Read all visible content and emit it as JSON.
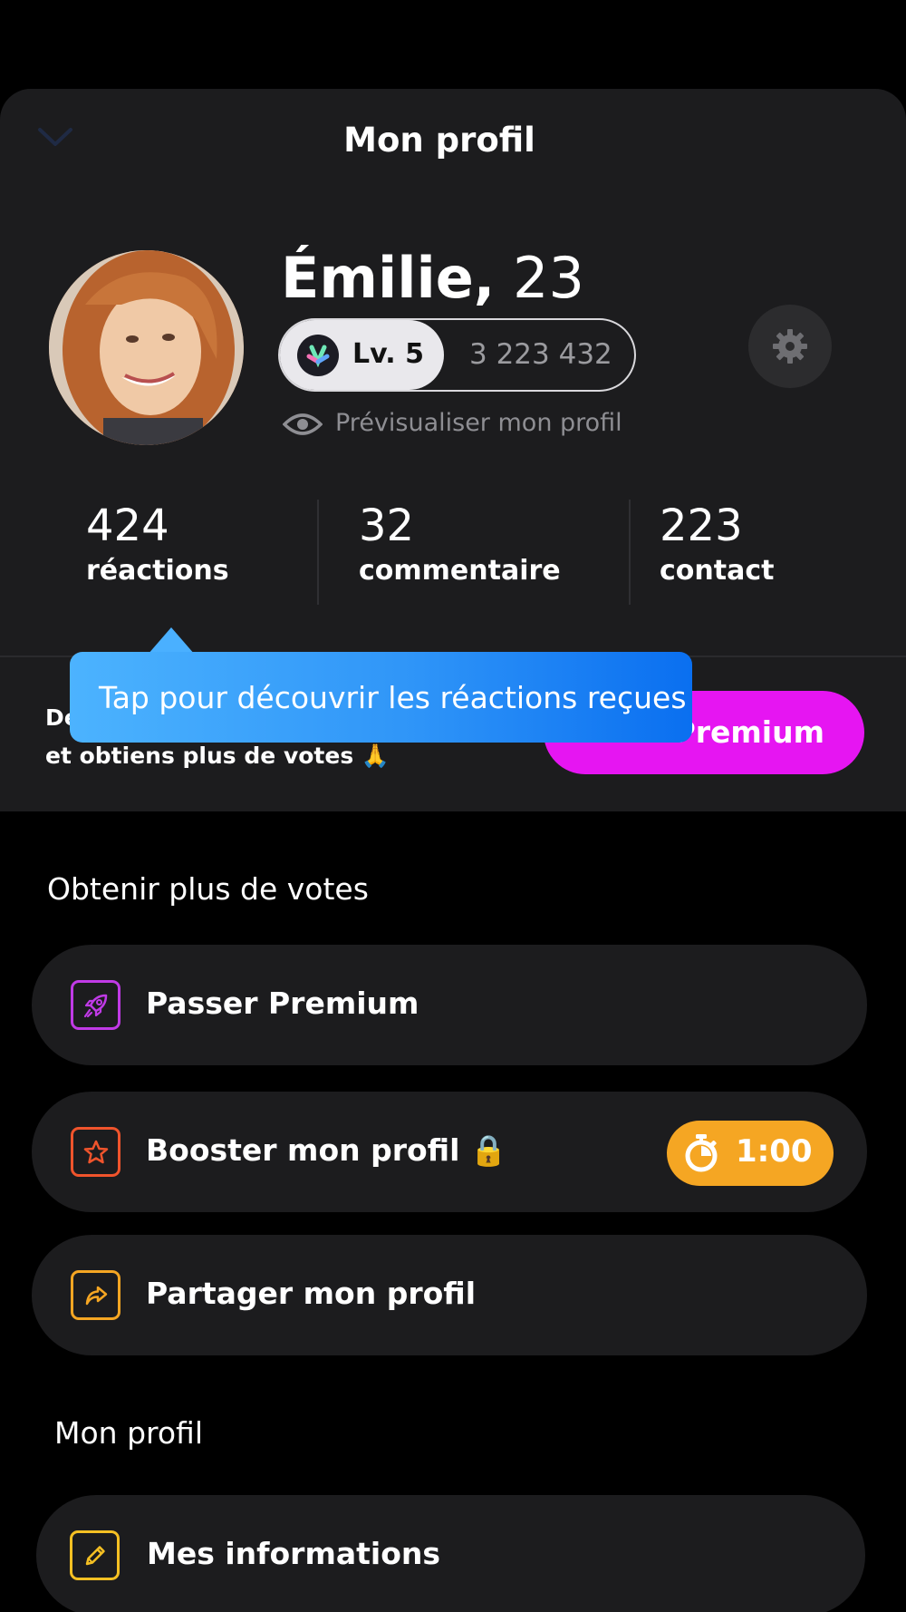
{
  "header": {
    "title": "Mon profil"
  },
  "profile": {
    "name": "Émilie,",
    "age": "23",
    "level": "Lv. 5",
    "points": "3 223 432",
    "preview_link": "Prévisualiser mon profil"
  },
  "stats": [
    {
      "value": "424",
      "label": "réactions"
    },
    {
      "value": "32",
      "label": "commentaire"
    },
    {
      "value": "223",
      "label": "contact"
    }
  ],
  "promo": {
    "text_line1": "De",
    "text_line2": "et obtiens plus de votes 🙏",
    "button": "Premium"
  },
  "tooltip": {
    "text": "Tap pour découvrir les réactions reçues"
  },
  "votes_section": {
    "title": "Obtenir plus de votes",
    "items": [
      {
        "label": "Passer Premium",
        "icon": "rocket-icon",
        "color": "#c03ae6"
      },
      {
        "label": "Booster mon profil 🔒",
        "icon": "star-icon",
        "color": "#f0542c",
        "timer": "1:00"
      },
      {
        "label": "Partager mon profil",
        "icon": "share-icon",
        "color": "#f5a623"
      }
    ]
  },
  "profile_section": {
    "title": "Mon profil",
    "items": [
      {
        "label": "Mes informations",
        "icon": "pencil-icon",
        "color": "#f5c023"
      }
    ]
  },
  "colors": {
    "premium": "#e615f2",
    "tooltip": "#2f95f8",
    "timer": "#f5a623",
    "sheet": "#1c1c1e"
  }
}
